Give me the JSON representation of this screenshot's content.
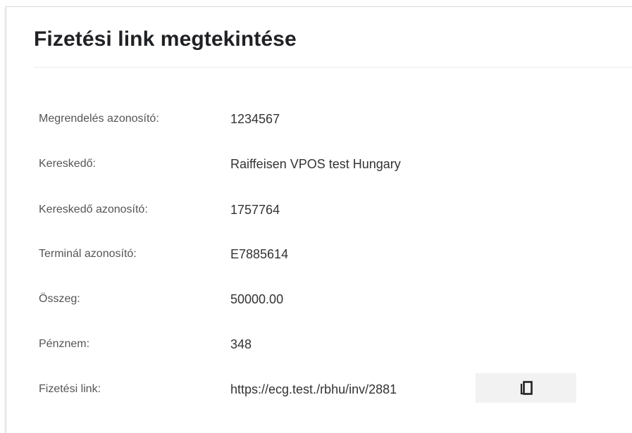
{
  "header": {
    "title": "Fizetési link megtekintése"
  },
  "details": {
    "rows": [
      {
        "label": "Megrendelés azonosító:",
        "value": "1234567"
      },
      {
        "label": "Kereskedő:",
        "value": "Raiffeisen VPOS test Hungary"
      },
      {
        "label": "Kereskedő azonosító:",
        "value": "1757764"
      },
      {
        "label": "Terminál azonosító:",
        "value": "E7885614"
      },
      {
        "label": "Összeg:",
        "value": "50000.00"
      },
      {
        "label": "Pénznem:",
        "value": "348"
      },
      {
        "label": "Fizetési link:",
        "value": "https://ecg.test./rbhu/inv/2881"
      }
    ]
  },
  "copy_button": {
    "icon": "copy-icon"
  },
  "colors": {
    "title_text": "#202124",
    "label_text": "#555555",
    "value_text": "#333333",
    "button_background": "#f2f2f2"
  }
}
